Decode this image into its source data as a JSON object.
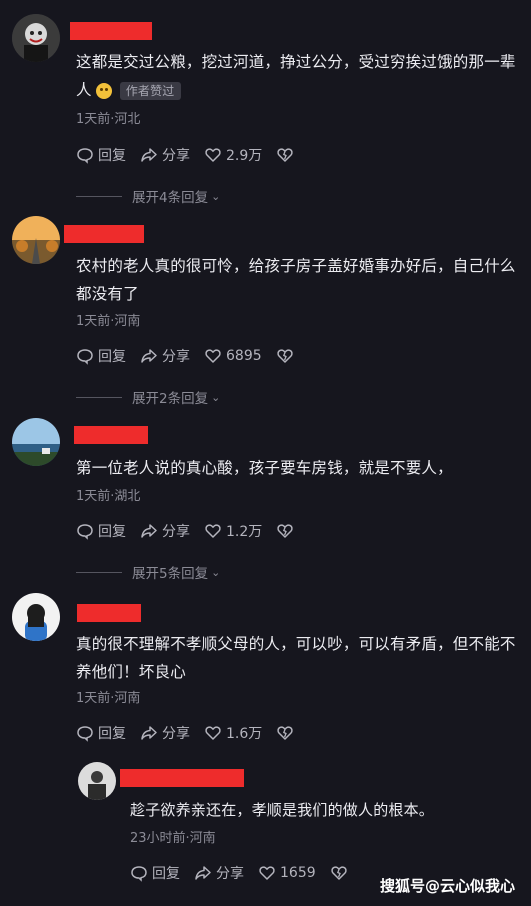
{
  "comments": [
    {
      "text": "这都是交过公粮，挖过河道，挣过公分，受过穷挨过饿的那一辈人",
      "tag": "作者赞过",
      "meta": "1天前·河北",
      "reply_label": "回复",
      "share_label": "分享",
      "likes": "2.9万",
      "expand": "展开4条回复"
    },
    {
      "text": "农村的老人真的很可怜，给孩子房子盖好婚事办好后，自己什么都没有了",
      "meta": "1天前·河南",
      "reply_label": "回复",
      "share_label": "分享",
      "likes": "6895",
      "expand": "展开2条回复"
    },
    {
      "text": "第一位老人说的真心酸，孩子要车房钱，就是不要人，",
      "meta": "1天前·湖北",
      "reply_label": "回复",
      "share_label": "分享",
      "likes": "1.2万",
      "expand": "展开5条回复"
    },
    {
      "text": "真的很不理解不孝顺父母的人，可以吵，可以有矛盾，但不能不养他们！坏良心",
      "meta": "1天前·河南",
      "reply_label": "回复",
      "share_label": "分享",
      "likes": "1.6万"
    }
  ],
  "reply": {
    "text": "趁子欲养亲还在，孝顺是我们的做人的根本。",
    "meta": "23小时前·河南",
    "reply_label": "回复",
    "share_label": "分享",
    "likes": "1659"
  },
  "watermark": "搜狐号@云心似我心",
  "colors": {
    "background": "#16161e",
    "redaction": "#ee2c2c",
    "meta": "#8b8b96"
  }
}
